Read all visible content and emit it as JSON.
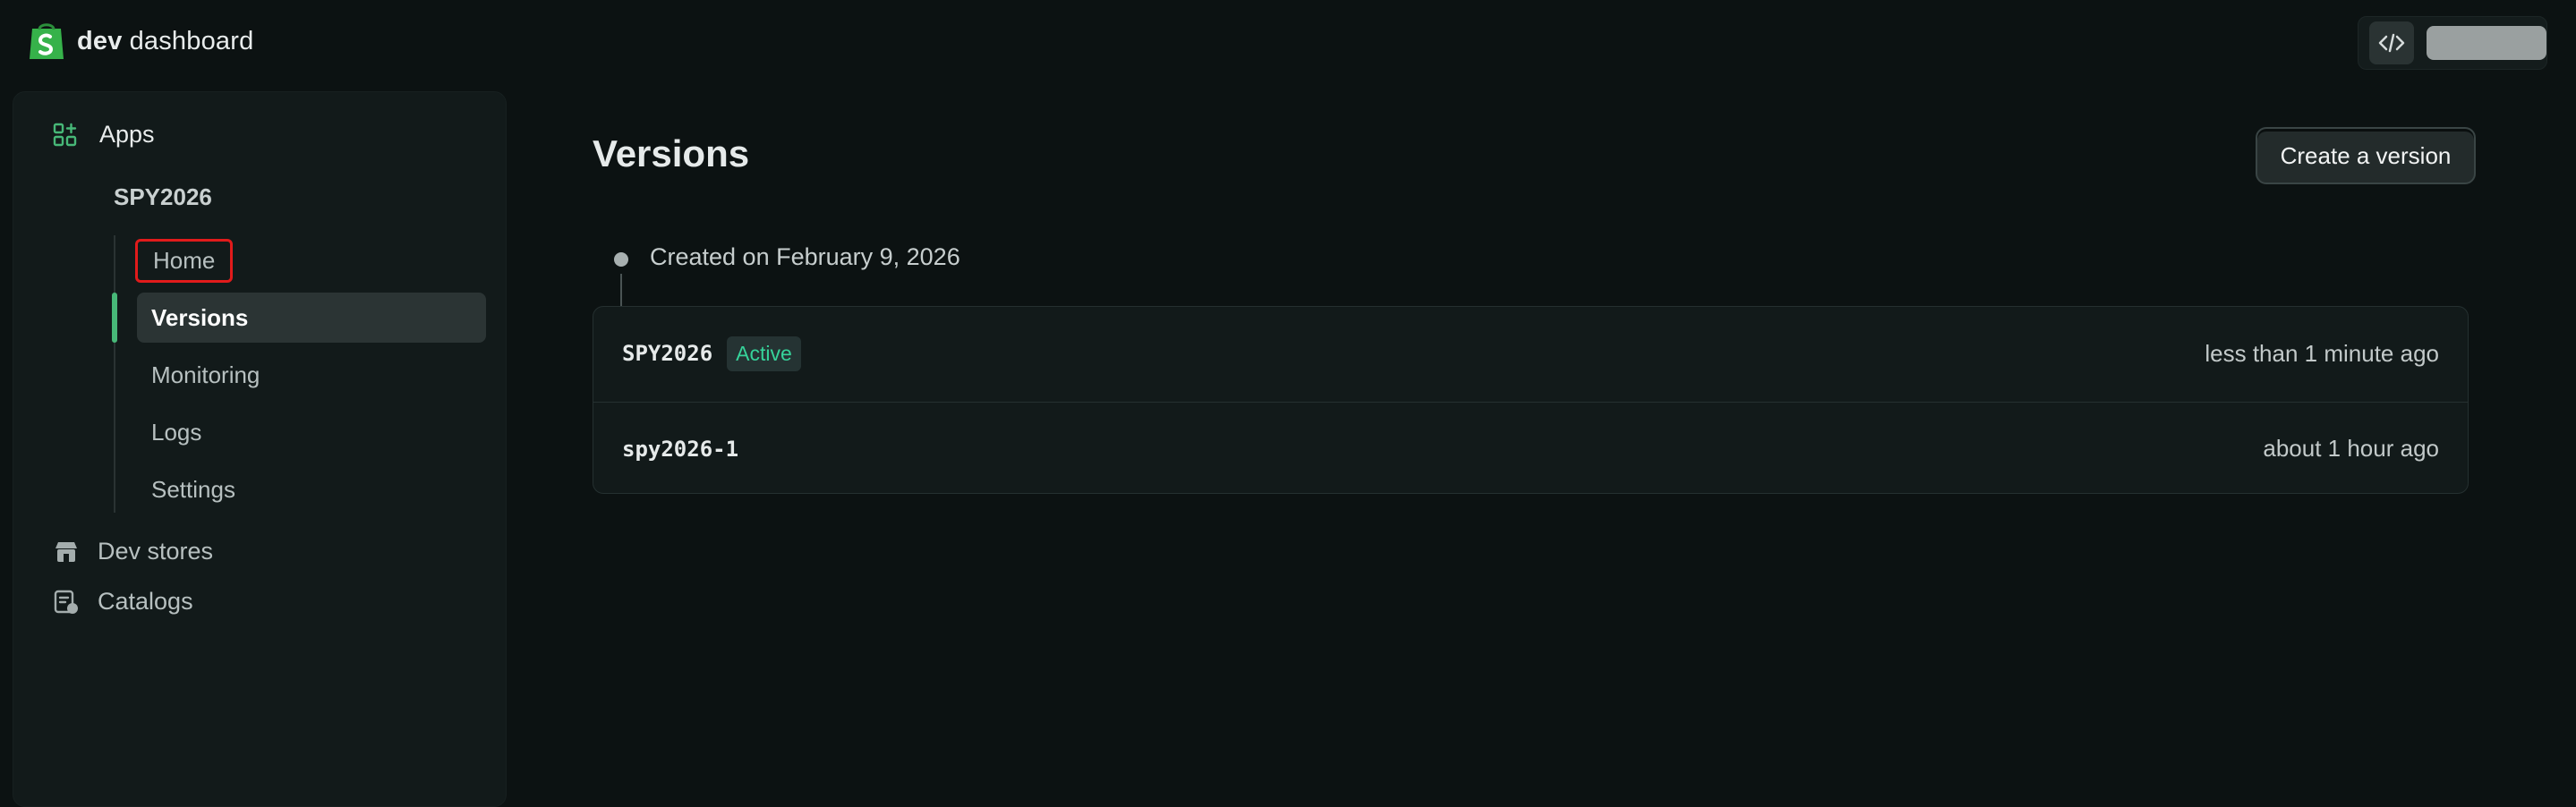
{
  "brand": {
    "name_bold": "dev",
    "name_rest": "dashboard"
  },
  "colors": {
    "accent": "#36d39a",
    "active_bar": "#47b878",
    "highlight": "#e11b1b",
    "bg": "#0c1212"
  },
  "sidebar": {
    "apps_label": "Apps",
    "app_name": "SPY2026",
    "subitems": [
      {
        "label": "Home",
        "selected": false,
        "highlighted": true
      },
      {
        "label": "Versions",
        "selected": true
      },
      {
        "label": "Monitoring"
      },
      {
        "label": "Logs"
      },
      {
        "label": "Settings"
      }
    ],
    "lower": [
      {
        "label": "Dev stores",
        "icon": "store-icon"
      },
      {
        "label": "Catalogs",
        "icon": "catalog-icon"
      }
    ]
  },
  "main": {
    "title": "Versions",
    "create_button": "Create a version",
    "timeline_text": "Created on February 9, 2026",
    "versions": [
      {
        "name": "SPY2026",
        "badge": "Active",
        "time": "less than 1 minute ago"
      },
      {
        "name": "spy2026-1",
        "time": "about 1 hour ago"
      }
    ]
  },
  "top_actions": {
    "icon": "code-icon"
  }
}
